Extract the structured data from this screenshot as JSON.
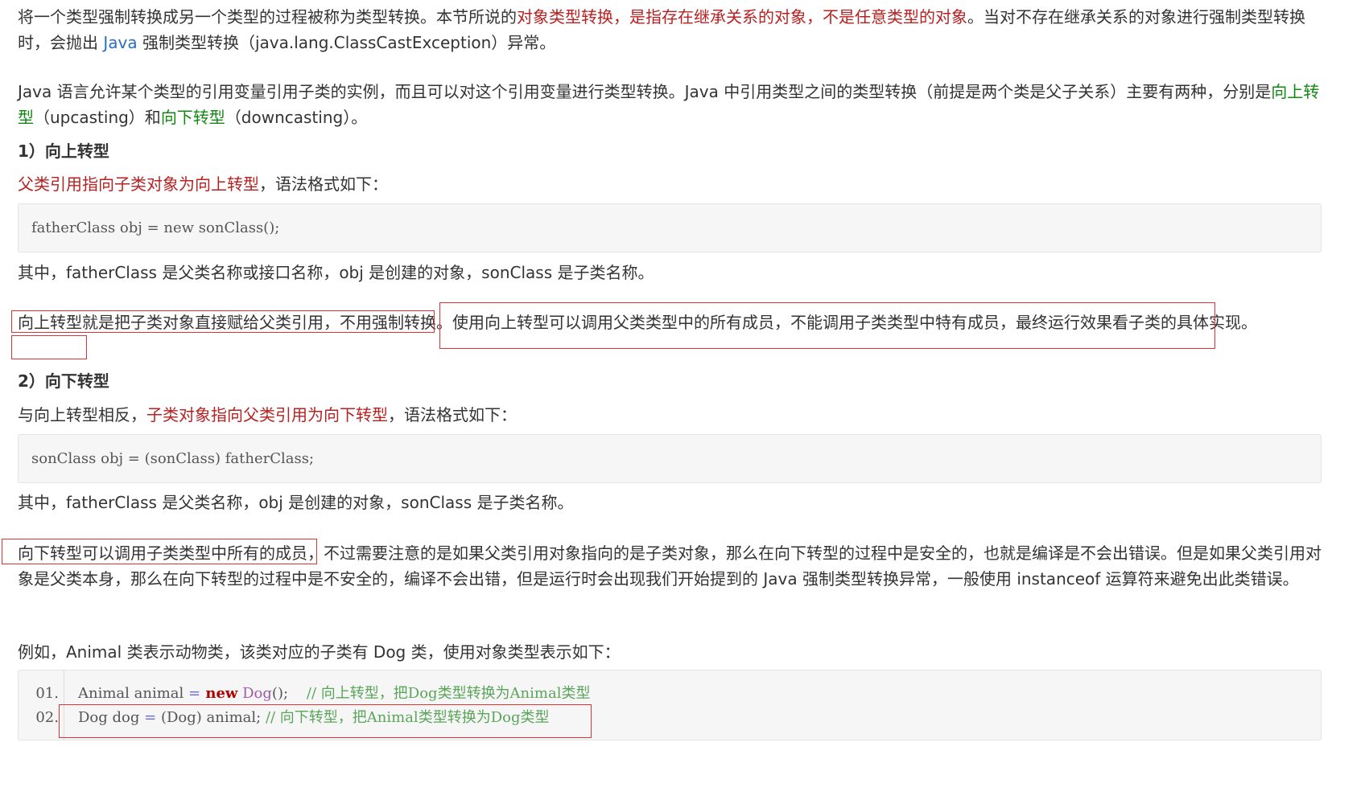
{
  "para1": {
    "a": "将一个类型强制转换成另一个类型的过程被称为类型转换。本节所说的",
    "b": "对象类型转换，是指存在继承关系的对象，不是任意类型的对象",
    "c": "。当对不存在继承关系的对象进行强制类型转换时，会抛出 ",
    "d": "Java",
    "e": " 强制类型转换（java.lang.ClassCastException）异常。"
  },
  "para2": {
    "a": "Java 语言允许某个类型的引用变量引用子类的实例，而且可以对这个引用变量进行类型转换。Java 中引用类型之间的类型转换（前提是两个类是父子关系）主要有两种，分别是",
    "b": "向上转型",
    "c": "（upcasting）和",
    "d": "向下转型",
    "e": "（downcasting）。"
  },
  "section_up": {
    "heading": "1）向上转型",
    "intro_red": "父类引用指向子类对象为向上转型",
    "intro_rest": "，语法格式如下：",
    "code": "fatherClass obj = new sonClass();",
    "explain": "其中，fatherClass 是父类名称或接口名称，obj 是创建的对象，sonClass 是子类名称。",
    "note_a": "向上转型就是把子类对象直接赋给父类引用，不用强制转换。",
    "note_b": "使用向上转型可以调用父类类型中的所有成员，不能调用子类类型中特有成员，最终运行效果看子类的具体实现。"
  },
  "section_down": {
    "heading": "2）向下转型",
    "intro_a": "与向上转型相反，",
    "intro_red": "子类对象指向父类引用为向下转型",
    "intro_rest": "，语法格式如下：",
    "code": "sonClass obj = (sonClass) fatherClass;",
    "explain": "其中，fatherClass 是父类名称，obj 是创建的对象，sonClass 是子类名称。",
    "note": "向下转型可以调用子类类型中所有的成员，不过需要注意的是如果父类引用对象指向的是子类对象，那么在向下转型的过程中是安全的，也就是编译是不会出错误。但是如果父类引用对象是父类本身，那么在向下转型的过程中是不安全的，编译不会出错，但是运行时会出现我们开始提到的 Java 强制类型转换异常，一般使用 instanceof 运算符来避免出此类错误。"
  },
  "example": {
    "intro": "例如，Animal 类表示动物类，该类对应的子类有 Dog 类，使用对象类型表示如下：",
    "line1_num": "01.",
    "line1_a": "Animal animal ",
    "line1_eq": "=",
    "line1_new": " new",
    "line1_cls": " Dog",
    "line1_end": "();",
    "line1_comment": "// 向上转型，把Dog类型转换为Animal类型",
    "line2_num": "02.",
    "line2_a": "Dog dog ",
    "line2_eq": "=",
    "line2_b": " (Dog) animal;",
    "line2_comment": "// 向下转型，把Animal类型转换为Dog类型"
  },
  "colors": {
    "red": "#b82121",
    "green": "#118811",
    "link": "#2a6fc2",
    "annotation_box": "#e03434"
  }
}
